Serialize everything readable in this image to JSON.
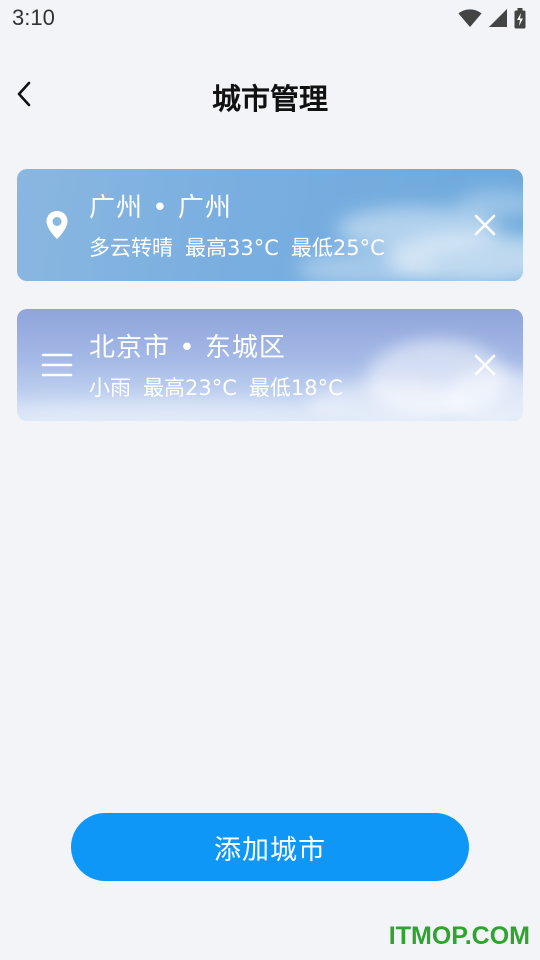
{
  "status_bar": {
    "time": "3:10",
    "icons": [
      "wifi-icon",
      "cellular-signal-icon",
      "battery-charging-icon"
    ]
  },
  "header": {
    "back_icon": "chevron-left-icon",
    "title": "城市管理"
  },
  "cities": [
    {
      "name": "广州 • 广州",
      "condition": "多云转晴",
      "high": "最高33°C",
      "low": "最低25°C",
      "lead_icon": "location-pin-icon",
      "remove_icon": "close-icon"
    },
    {
      "name": "北京市 • 东城区",
      "condition": "小雨",
      "high": "最高23°C",
      "low": "最低18°C",
      "lead_icon": "drag-handle-icon",
      "remove_icon": "close-icon"
    }
  ],
  "add_button": {
    "label": "添加城市"
  },
  "watermark": "ITMOP.COM",
  "colors": {
    "background": "#f2f4f8",
    "primary": "#0f97f8",
    "watermark": "#2fa42f"
  }
}
